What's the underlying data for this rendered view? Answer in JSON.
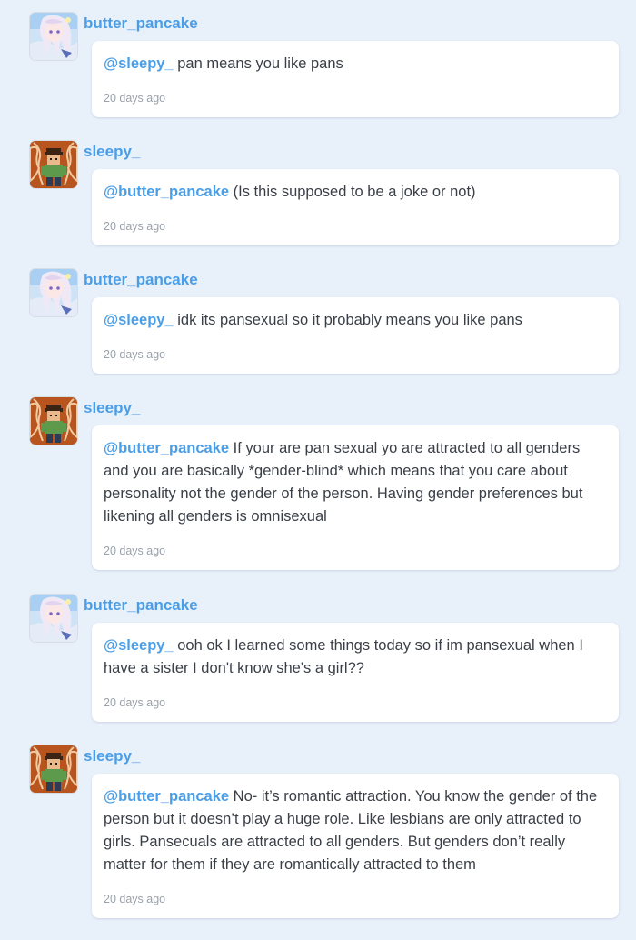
{
  "comments": [
    {
      "username": "butter_pancake",
      "avatar": "anime-girl-avatar",
      "mention": "@sleepy_",
      "text": " pan means you like pans",
      "time": "20 days ago"
    },
    {
      "username": "sleepy_",
      "avatar": "pixel-boy-avatar",
      "mention": "@butter_pancake",
      "text": " (Is this supposed to be a joke or not)",
      "time": "20 days ago"
    },
    {
      "username": "butter_pancake",
      "avatar": "anime-girl-avatar",
      "mention": "@sleepy_",
      "text": " idk its pansexual so it probably means you like pans",
      "time": "20 days ago"
    },
    {
      "username": "sleepy_",
      "avatar": "pixel-boy-avatar",
      "mention": "@butter_pancake",
      "text": " If your are pan sexual yo are attracted to all genders and you are basically *gender-blind* which means that you care about personality not the gender of the person. Having gender preferences but likening all genders is omnisexual",
      "time": "20 days ago"
    },
    {
      "username": "butter_pancake",
      "avatar": "anime-girl-avatar",
      "mention": "@sleepy_",
      "text": " ooh ok I learned some things today so if im pansexual when I have a sister I don't know she's a girl??",
      "time": "20 days ago"
    },
    {
      "username": "sleepy_",
      "avatar": "pixel-boy-avatar",
      "mention": "@butter_pancake",
      "text": " No- it’s romantic attraction. You know the gender of the person but it doesn’t play a huge role. Like lesbians are only attracted to girls. Pansecuals are attracted to all genders. But genders don’t really matter for them if they are romantically attracted to them",
      "time": "20 days ago"
    }
  ],
  "colors": {
    "background": "#e8f0fa",
    "accent": "#4a9ee8",
    "text": "#3a3f47",
    "muted": "#9aa1ab"
  }
}
